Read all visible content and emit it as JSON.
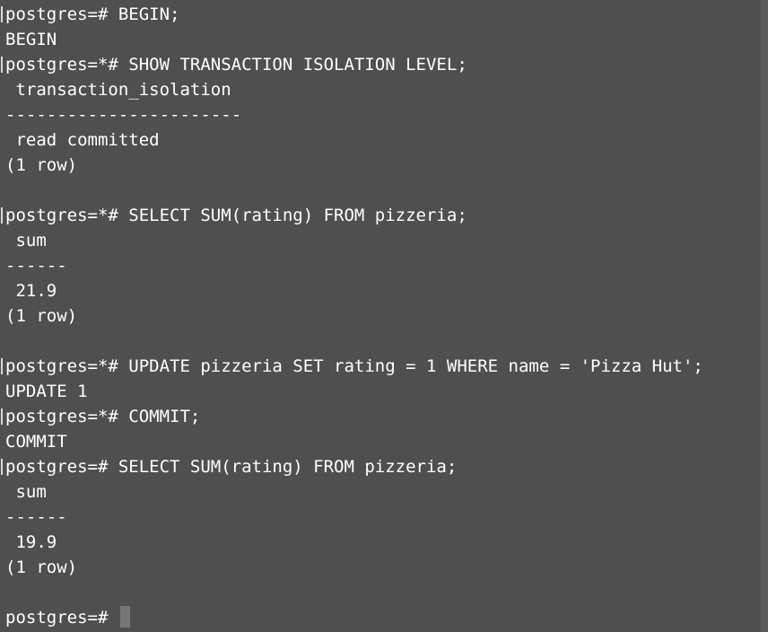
{
  "terminal": {
    "lines": [
      {
        "text": "postgres=# BEGIN;",
        "prompt": true
      },
      {
        "text": "BEGIN",
        "prompt": false
      },
      {
        "text": "postgres=*# SHOW TRANSACTION ISOLATION LEVEL;",
        "prompt": true
      },
      {
        "text": " transaction_isolation",
        "prompt": false
      },
      {
        "text": "-----------------------",
        "prompt": false
      },
      {
        "text": " read committed",
        "prompt": false
      },
      {
        "text": "(1 row)",
        "prompt": false
      },
      {
        "text": "",
        "prompt": false
      },
      {
        "text": "postgres=*# SELECT SUM(rating) FROM pizzeria;",
        "prompt": true
      },
      {
        "text": " sum",
        "prompt": false
      },
      {
        "text": "------",
        "prompt": false
      },
      {
        "text": " 21.9",
        "prompt": false
      },
      {
        "text": "(1 row)",
        "prompt": false
      },
      {
        "text": "",
        "prompt": false
      },
      {
        "text": "postgres=*# UPDATE pizzeria SET rating = 1 WHERE name = 'Pizza Hut';",
        "prompt": true
      },
      {
        "text": "UPDATE 1",
        "prompt": false
      },
      {
        "text": "postgres=*# COMMIT;",
        "prompt": true
      },
      {
        "text": "COMMIT",
        "prompt": false
      },
      {
        "text": "postgres=# SELECT SUM(rating) FROM pizzeria;",
        "prompt": true
      },
      {
        "text": " sum",
        "prompt": false
      },
      {
        "text": "------",
        "prompt": false
      },
      {
        "text": " 19.9",
        "prompt": false
      },
      {
        "text": "(1 row)",
        "prompt": false
      },
      {
        "text": "",
        "prompt": false
      }
    ],
    "current_prompt": "postgres=# "
  },
  "colors": {
    "background": "#4f4f4f",
    "text": "#ffffff",
    "cursor": "#777777"
  }
}
